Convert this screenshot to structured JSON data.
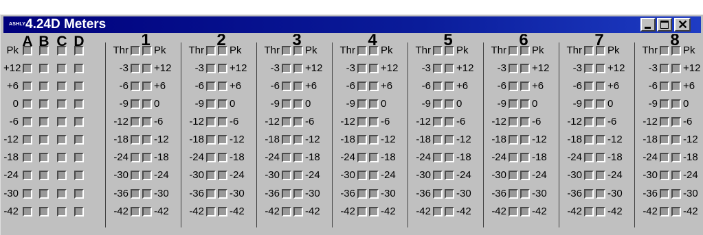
{
  "window": {
    "logo": "ASHLY",
    "title": "4.24D Meters",
    "buttons": {
      "minimize": "_",
      "maximize": "□",
      "close": "X"
    }
  },
  "input_section": {
    "headers": [
      "A",
      "B",
      "C",
      "D"
    ],
    "levels": [
      "Pk",
      "+12",
      "+6",
      "0",
      "-6",
      "-12",
      "-18",
      "-24",
      "-30",
      "-42"
    ]
  },
  "channels": [
    "1",
    "2",
    "3",
    "4",
    "5",
    "6",
    "7",
    "8"
  ],
  "channel_top_left": "Thr",
  "channel_top_right": "Pk",
  "threshold_levels": [
    "-3",
    "-6",
    "-9",
    "-12",
    "-18",
    "-24",
    "-30",
    "-36",
    "-42"
  ],
  "level_levels": [
    "+12",
    "+6",
    "0",
    "-6",
    "-12",
    "-18",
    "-24",
    "-30",
    "-42"
  ],
  "colors": {
    "title_bar": "#00007c",
    "window": "#c0c0c0",
    "led_off": "#9a9a9a"
  }
}
